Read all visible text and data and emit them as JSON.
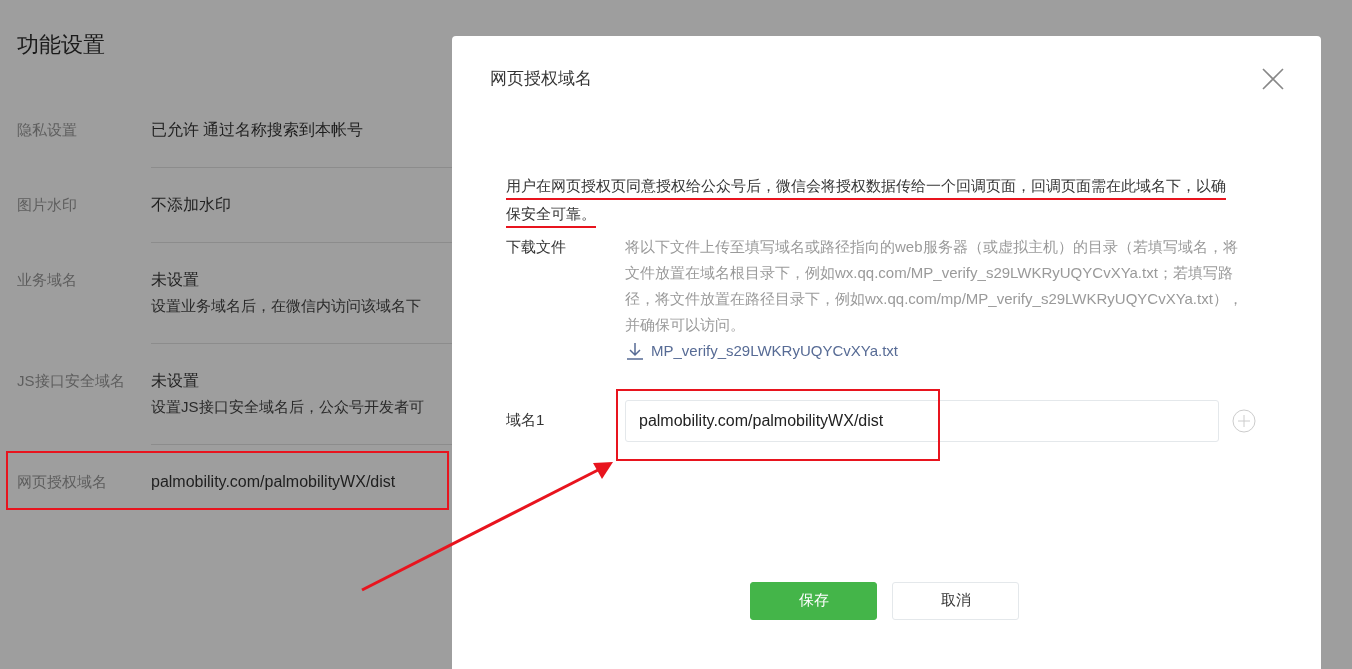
{
  "page": {
    "title": "功能设置"
  },
  "settings": [
    {
      "label": "隐私设置",
      "value": "已允许 通过名称搜索到本帐号"
    },
    {
      "label": "图片水印",
      "value": "不添加水印"
    },
    {
      "label": "业务域名",
      "value": "未设置",
      "note": "设置业务域名后，在微信内访问该域名下"
    },
    {
      "label": "JS接口安全域名",
      "value": "未设置",
      "note": "设置JS接口安全域名后，公众号开发者可"
    },
    {
      "label": "网页授权域名",
      "value": "palmobility.com/palmobilityWX/dist"
    }
  ],
  "dialog": {
    "title": "网页授权域名",
    "description": "用户在网页授权页同意授权给公众号后，微信会将授权数据传给一个回调页面，回调页面需在此域名下，以确保安全可靠。",
    "download": {
      "label": "下载文件",
      "text": "将以下文件上传至填写域名或路径指向的web服务器（或虚拟主机）的目录（若填写域名，将文件放置在域名根目录下，例如wx.qq.com/MP_verify_s29LWKRyUQYCvXYa.txt；若填写路径，将文件放置在路径目录下，例如wx.qq.com/mp/MP_verify_s29LWKRyUQYCvXYa.txt），并确保可以访问。",
      "file": "MP_verify_s29LWKRyUQYCvXYa.txt"
    },
    "domains": [
      {
        "label": "域名1",
        "value": "palmobility.com/palmobilityWX/dist"
      }
    ],
    "buttons": [
      {
        "label": "保存",
        "kind": "primary"
      },
      {
        "label": "取消",
        "kind": "default"
      }
    ]
  }
}
